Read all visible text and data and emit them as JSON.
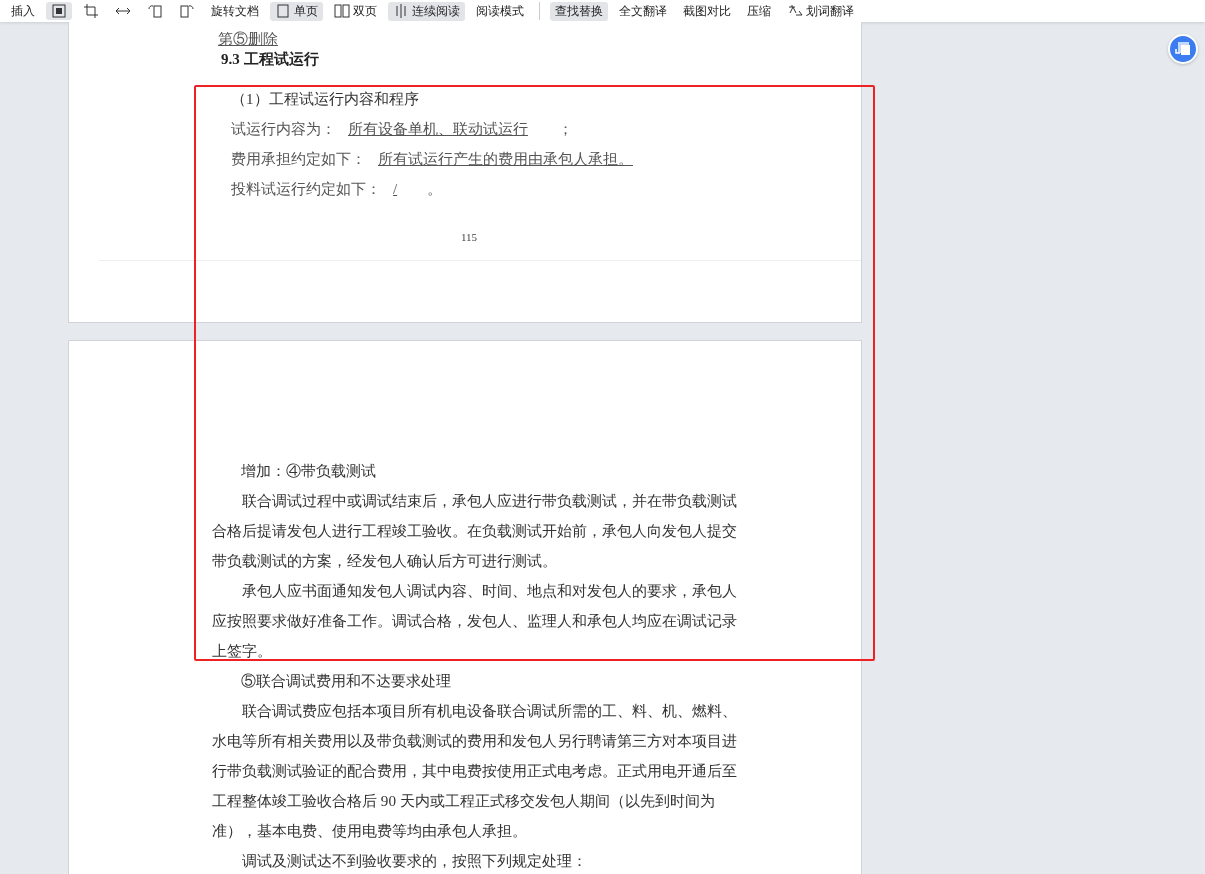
{
  "toolbar": {
    "items": [
      {
        "kind": "text",
        "label": "插入",
        "selected": false
      },
      {
        "kind": "icon",
        "selected": true
      },
      {
        "kind": "icon",
        "selected": false
      },
      {
        "kind": "icon",
        "selected": false
      },
      {
        "kind": "icon",
        "selected": false
      },
      {
        "kind": "icon",
        "selected": false
      },
      {
        "kind": "text",
        "label": "旋转文档",
        "selected": false
      },
      {
        "kind": "icon-text",
        "label": "单页",
        "selected": true
      },
      {
        "kind": "icon-text",
        "label": "双页",
        "selected": false
      },
      {
        "kind": "icon-text",
        "label": "连续阅读",
        "selected": true
      },
      {
        "kind": "text",
        "label": "阅读模式",
        "selected": false
      },
      {
        "kind": "separator"
      },
      {
        "kind": "text",
        "label": "查找替换",
        "selected": true
      },
      {
        "kind": "text",
        "label": "全文翻译",
        "selected": false
      },
      {
        "kind": "text",
        "label": "截图对比",
        "selected": false
      },
      {
        "kind": "text",
        "label": "压缩",
        "selected": false
      },
      {
        "kind": "icon-text",
        "label": "划词翻译",
        "selected": false
      }
    ]
  },
  "pages": [
    {
      "blocks": [
        {
          "kind": "link",
          "text": "第⑤删除"
        },
        {
          "kind": "heading",
          "text": "9.3 工程试运行"
        },
        {
          "kind": "subheading",
          "text": "（1）工程试运行内容和程序"
        },
        {
          "kind": "fill",
          "label": "试运行内容为：",
          "value": "所有设备单机、联动试运行",
          "suffix": "；"
        },
        {
          "kind": "fill",
          "label": "费用承担约定如下：",
          "value": "所有试运行产生的费用由承包人承担。"
        },
        {
          "kind": "fill",
          "label": "投料试运行约定如下：",
          "value": "/",
          "suffix": "。"
        },
        {
          "kind": "page-number",
          "text": "115"
        }
      ]
    },
    {
      "blocks": [
        {
          "kind": "spacer"
        },
        {
          "kind": "subheading",
          "text": "增加：④带负载测试"
        },
        {
          "kind": "paragraph",
          "text": "联合调试过程中或调试结束后，承包人应进行带负载测试，并在带负载测试合格后提请发包人进行工程竣工验收。在负载测试开始前，承包人向发包人提交带负载测试的方案，经发包人确认后方可进行测试。"
        },
        {
          "kind": "paragraph",
          "text": "承包人应书面通知发包人调试内容、时间、地点和对发包人的要求，承包人应按照要求做好准备工作。调试合格，发包人、监理人和承包人均应在调试记录上签字。"
        },
        {
          "kind": "subheading",
          "text": "⑤联合调试费用和不达要求处理"
        },
        {
          "kind": "paragraph",
          "text": "联合调试费应包括本项目所有机电设备联合调试所需的工、料、机、燃料、水电等所有相关费用以及带负载测试的费用和发包人另行聘请第三方对本项目进行带负载测试验证的配合费用，其中电费按使用正式电考虑。正式用电开通后至工程整体竣工验收合格后 90 天内或工程正式移交发包人期间（以先到时间为准），基本电费、使用电费等均由承包人承担。"
        },
        {
          "kind": "paragraph",
          "text": "调试及测试达不到验收要求的，按照下列规定处理："
        }
      ]
    }
  ],
  "annotation": {
    "kind": "rectangle",
    "color": "#ee2222"
  }
}
